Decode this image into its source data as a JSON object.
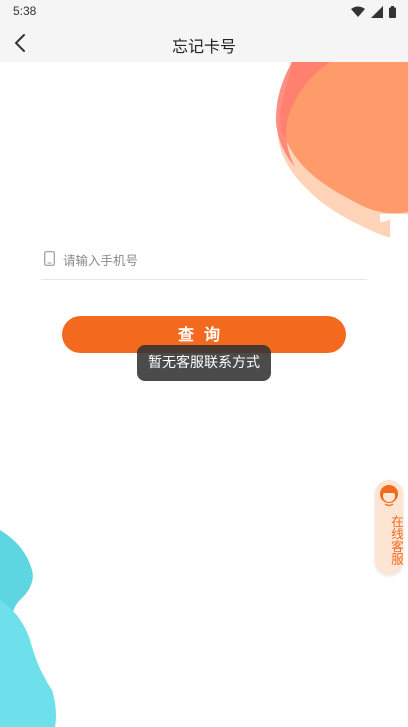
{
  "status_bar": {
    "time": "5:38",
    "icons": [
      "wifi-icon",
      "signal-icon",
      "battery-icon"
    ]
  },
  "nav": {
    "title": "忘记卡号",
    "back_icon": "chevron-left-icon"
  },
  "form": {
    "phone_placeholder": "请输入手机号",
    "phone_value": "",
    "phone_icon": "phone-icon"
  },
  "query_button": {
    "label": "查询"
  },
  "toast": {
    "message": "暂无客服联系方式"
  },
  "service": {
    "label": "在线客服",
    "icon": "customer-service-avatar-icon"
  },
  "colors": {
    "accent": "#f36a1e",
    "deco_top": "#ff9a6a",
    "deco_bottom": "#5dd6e2",
    "nav_bg": "#f5f5f5",
    "toast_bg": "#333333"
  }
}
